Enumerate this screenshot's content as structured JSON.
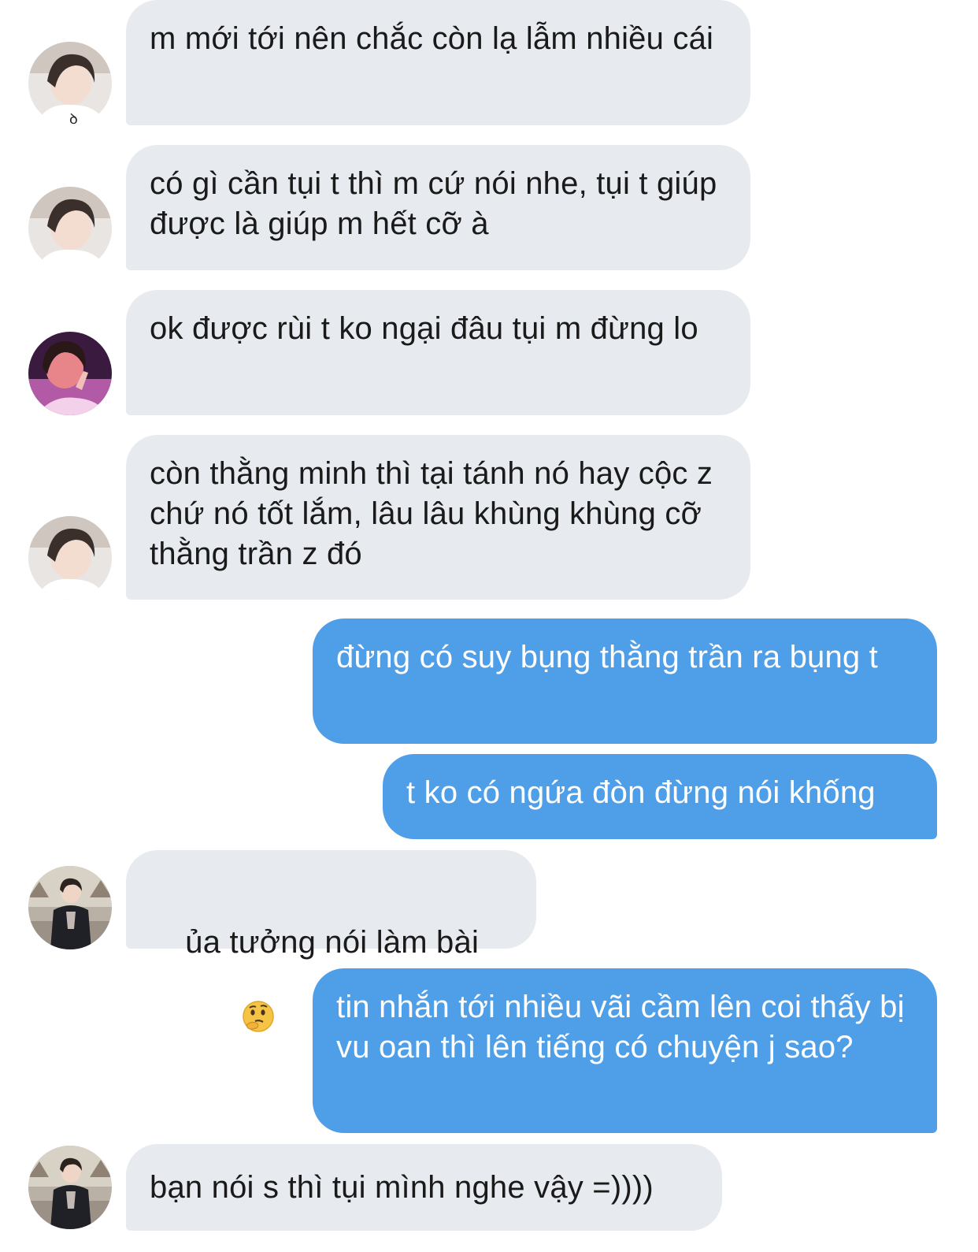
{
  "messages": [
    {
      "sender": "incoming",
      "avatar": "user-a",
      "text": "m mới tới nên chắc còn lạ lẫm nhiều cái"
    },
    {
      "sender": "incoming",
      "avatar": "user-a",
      "text": "có gì cần tụi t thì m cứ nói nhe, tụi t giúp được là giúp m hết cỡ à"
    },
    {
      "sender": "incoming",
      "avatar": "user-b",
      "text": "ok được rùi t ko ngại đâu tụi m đừng lo"
    },
    {
      "sender": "incoming",
      "avatar": "user-a",
      "text": "còn thằng minh thì tại tánh nó hay cộc z chứ nó tốt lắm, lâu lâu khùng khùng cỡ thằng trần z đó"
    },
    {
      "sender": "outgoing",
      "text": "đừng có suy bụng thằng trần ra bụng t"
    },
    {
      "sender": "outgoing",
      "text": "t ko có ngứa đòn đừng nói khống"
    },
    {
      "sender": "incoming",
      "avatar": "user-c",
      "text": "ủa tưởng nói làm bài",
      "emoji": "thinking-face-emoji"
    },
    {
      "sender": "outgoing",
      "text": "tin nhắn tới nhiều vãi cầm lên coi thấy bị vu oan thì lên tiếng có chuyện j sao?"
    },
    {
      "sender": "incoming",
      "avatar": "user-c",
      "text": "bạn nói s thì tụi mình nghe vậy =))))"
    }
  ],
  "colors": {
    "incoming_bubble": "#e7eaee",
    "outgoing_bubble": "#4f9fe8",
    "incoming_text": "#1a1a1a",
    "outgoing_text": "#ffffff"
  }
}
